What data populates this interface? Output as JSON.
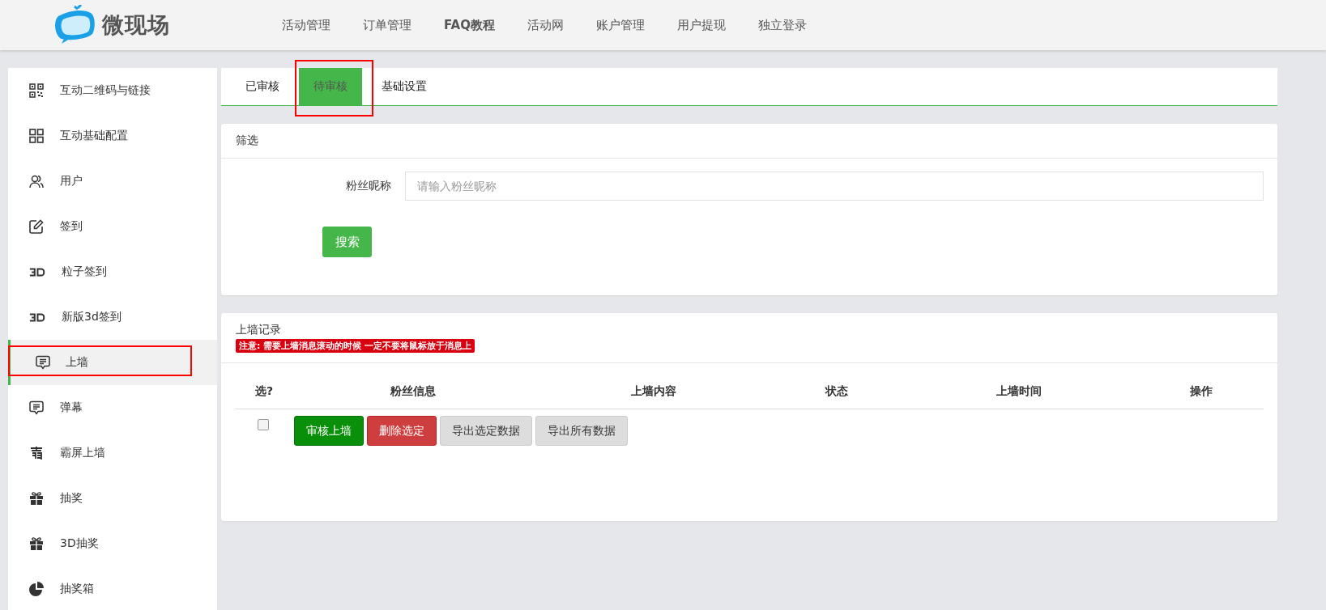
{
  "header": {
    "logo_text": "微现场",
    "nav": [
      {
        "label": "活动管理",
        "bold": false
      },
      {
        "label": "订单管理",
        "bold": false
      },
      {
        "label": "FAQ教程",
        "bold": true
      },
      {
        "label": "活动网",
        "bold": false
      },
      {
        "label": "账户管理",
        "bold": false
      },
      {
        "label": "用户提现",
        "bold": false
      },
      {
        "label": "独立登录",
        "bold": false
      }
    ]
  },
  "sidebar": {
    "items": [
      {
        "label": "互动二维码与链接",
        "kind": "qr",
        "selected": false,
        "highlighted": false
      },
      {
        "label": "互动基础配置",
        "kind": "grid",
        "selected": false,
        "highlighted": false
      },
      {
        "label": "用户",
        "kind": "users",
        "selected": false,
        "highlighted": false
      },
      {
        "label": "签到",
        "kind": "edit",
        "selected": false,
        "highlighted": false
      },
      {
        "label": "粒子签到",
        "kind": "threed",
        "selected": false,
        "highlighted": false
      },
      {
        "label": "新版3d签到",
        "kind": "threed",
        "selected": false,
        "highlighted": false
      },
      {
        "label": "上墙",
        "kind": "message",
        "selected": true,
        "highlighted": true
      },
      {
        "label": "弹幕",
        "kind": "message",
        "selected": false,
        "highlighted": false
      },
      {
        "label": "霸屏上墙",
        "kind": "glyph",
        "selected": false,
        "highlighted": false
      },
      {
        "label": "抽奖",
        "kind": "gift",
        "selected": false,
        "highlighted": false
      },
      {
        "label": "3D抽奖",
        "kind": "gift",
        "selected": false,
        "highlighted": false
      },
      {
        "label": "抽奖箱",
        "kind": "pie",
        "selected": false,
        "highlighted": false
      }
    ]
  },
  "tabs": [
    {
      "label": "已审核",
      "selected": false,
      "highlighted": false
    },
    {
      "label": "待审核",
      "selected": true,
      "highlighted": true
    },
    {
      "label": "基础设置",
      "selected": false,
      "highlighted": false
    }
  ],
  "filter": {
    "title": "筛选",
    "field_label": "粉丝昵称",
    "placeholder": "请输入粉丝昵称",
    "search_button": "搜索"
  },
  "records": {
    "title": "上墙记录",
    "notice": "注意: 需要上墙消息滚动的时候 一定不要将鼠标放于消息上",
    "columns": [
      "选?",
      "粉丝信息",
      "上墙内容",
      "状态",
      "上墙时间",
      "操作"
    ],
    "select_all": {
      "checked": false
    },
    "actions": [
      {
        "label": "审核上墙",
        "kind": "approve"
      },
      {
        "label": "删除选定",
        "kind": "delete"
      },
      {
        "label": "导出选定数据",
        "kind": "plain"
      },
      {
        "label": "导出所有数据",
        "kind": "plain"
      }
    ]
  }
}
